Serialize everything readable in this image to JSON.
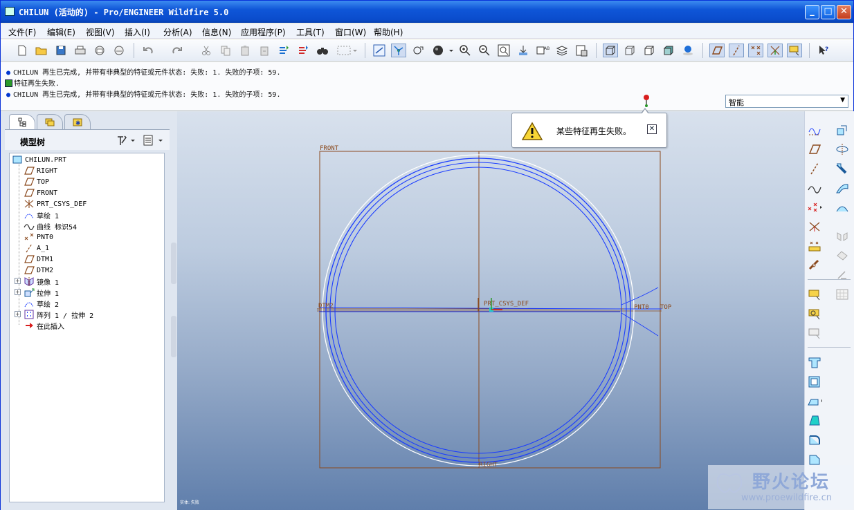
{
  "window": {
    "title": "CHILUN (活动的) - Pro/ENGINEER Wildfire 5.0"
  },
  "menu": [
    "文件(F)",
    "编辑(E)",
    "视图(V)",
    "插入(I)",
    "分析(A)",
    "信息(N)",
    "应用程序(P)",
    "工具(T)",
    "窗口(W)",
    "帮助(H)"
  ],
  "messages": [
    "CHILUN 再生已完成, 并带有非典型的特征或元件状态: 失败: 1. 失败的子项: 59.",
    "特征再生失败.",
    "CHILUN 再生已完成, 并带有非典型的特征或元件状态: 失败: 1. 失败的子项: 59."
  ],
  "smart_filter": "智能",
  "model_tree": {
    "header": "模型树",
    "root": "CHILUN.PRT",
    "items": [
      {
        "label": "RIGHT",
        "icon": "datum-plane-icon"
      },
      {
        "label": "TOP",
        "icon": "datum-plane-icon"
      },
      {
        "label": "FRONT",
        "icon": "datum-plane-icon"
      },
      {
        "label": "PRT_CSYS_DEF",
        "icon": "csys-icon"
      },
      {
        "label": "草绘 1",
        "icon": "sketch-icon"
      },
      {
        "label": "曲线 标识54",
        "icon": "curve-icon"
      },
      {
        "label": "PNT0",
        "icon": "datum-point-icon"
      },
      {
        "label": "A_1",
        "icon": "datum-axis-icon"
      },
      {
        "label": "DTM1",
        "icon": "datum-plane-icon"
      },
      {
        "label": "DTM2",
        "icon": "datum-plane-icon"
      },
      {
        "label": "镜像 1",
        "icon": "mirror-icon",
        "expandable": true
      },
      {
        "label": "拉伸 1",
        "icon": "extrude-icon",
        "expandable": true
      },
      {
        "label": "草绘 2",
        "icon": "sketch-icon"
      },
      {
        "label": "阵列 1 / 拉伸 2",
        "icon": "pattern-icon",
        "expandable": true
      },
      {
        "label": "在此插入",
        "icon": "insert-here-arrow-icon"
      }
    ]
  },
  "viewport": {
    "datum_labels": {
      "front": "FRONT",
      "right": "RIGHT",
      "top": "TOP",
      "dtm2": "DTM2",
      "csys": "PRT_CSYS_DEF",
      "pnt": "PNT0"
    },
    "status": "实体: 失败"
  },
  "popup": {
    "message": "某些特征再生失败。"
  },
  "watermark": {
    "title": "野火论坛",
    "url": "www.proewildfire.cn"
  },
  "colors": {
    "title_bar": "#0a4ccc",
    "datum": "#8b4a1e",
    "geometry": "#1a3cff",
    "viewport_bottom": "#5f7eab"
  }
}
